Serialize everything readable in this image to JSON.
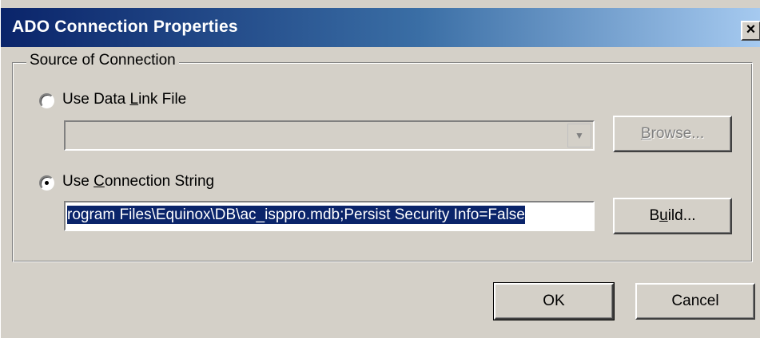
{
  "window": {
    "title": "ADO Connection Properties",
    "close_glyph": "×"
  },
  "group": {
    "legend": "Source of Connection"
  },
  "options": {
    "data_link": {
      "label_pre": "Use Data ",
      "label_key": "L",
      "label_post": "ink File",
      "selected": false
    },
    "connection_string": {
      "label_pre": "Use ",
      "label_key": "C",
      "label_post": "onnection String",
      "selected": true
    }
  },
  "data_link_combo": {
    "value": "",
    "arrow_icon": "chevron-down-icon"
  },
  "connection_input": {
    "value": "rogram Files\\Equinox\\DB\\ac_isppro.mdb;Persist Security Info=False"
  },
  "buttons": {
    "browse": {
      "label_pre": "",
      "label_key": "B",
      "label_post": "rowse...",
      "enabled": false
    },
    "build": {
      "label_pre": "B",
      "label_key": "u",
      "label_post": "ild...",
      "enabled": true
    },
    "ok": {
      "label": "OK"
    },
    "cancel": {
      "label": "Cancel"
    }
  },
  "colors": {
    "titlebar_start": "#0a246a",
    "titlebar_end": "#a6caf0",
    "face": "#d4d0c8",
    "selection": "#0a246a"
  }
}
